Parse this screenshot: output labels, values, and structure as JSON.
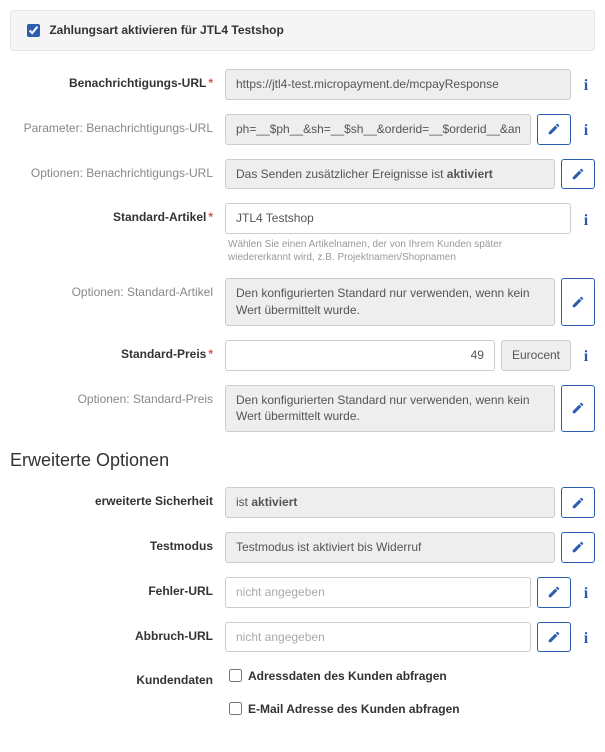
{
  "header": {
    "activate_label": "Zahlungsart aktivieren für JTL4 Testshop",
    "activate_checked": true
  },
  "fields": {
    "notify_url": {
      "label": "Benachrichtigungs-URL",
      "value": "https://jtl4-test.micropayment.de/mcpayResponse"
    },
    "notify_params": {
      "label": "Parameter: Benachrichtigungs-URL",
      "value": "ph=__$ph__&sh=__$sh__&orderid=__$orderid__&amour"
    },
    "notify_options": {
      "label": "Optionen: Benachrichtigungs-URL",
      "prefix": "Das Senden zusätzlicher Ereignisse ist ",
      "state": "aktiviert"
    },
    "std_article": {
      "label": "Standard-Artikel",
      "value": "JTL4 Testshop",
      "helper": "Wählen Sie einen Artikelnamen, der von Ihrem Kunden später wiedererkannt wird, z.B. Projektnamen/Shopnamen"
    },
    "std_article_options": {
      "label": "Optionen: Standard-Artikel",
      "text": "Den konfigurierten Standard nur verwenden, wenn kein Wert übermittelt wurde."
    },
    "std_price": {
      "label": "Standard-Preis",
      "value": "49",
      "unit": "Eurocent"
    },
    "std_price_options": {
      "label": "Optionen: Standard-Preis",
      "text": "Den konfigurierten Standard nur verwenden, wenn kein Wert übermittelt wurde."
    }
  },
  "advanced": {
    "heading": "Erweiterte Optionen",
    "security": {
      "label": "erweiterte Sicherheit",
      "prefix": "ist ",
      "state": "aktiviert"
    },
    "testmode": {
      "label": "Testmodus",
      "text": "Testmodus ist aktiviert bis Widerruf"
    },
    "error_url": {
      "label": "Fehler-URL",
      "placeholder": "nicht angegeben",
      "value": ""
    },
    "abort_url": {
      "label": "Abbruch-URL",
      "placeholder": "nicht angegeben",
      "value": ""
    },
    "customer": {
      "label": "Kundendaten",
      "address_label": "Adressdaten des Kunden abfragen",
      "address_checked": false,
      "email_label": "E-Mail Adresse des Kunden abfragen",
      "email_checked": false
    }
  }
}
